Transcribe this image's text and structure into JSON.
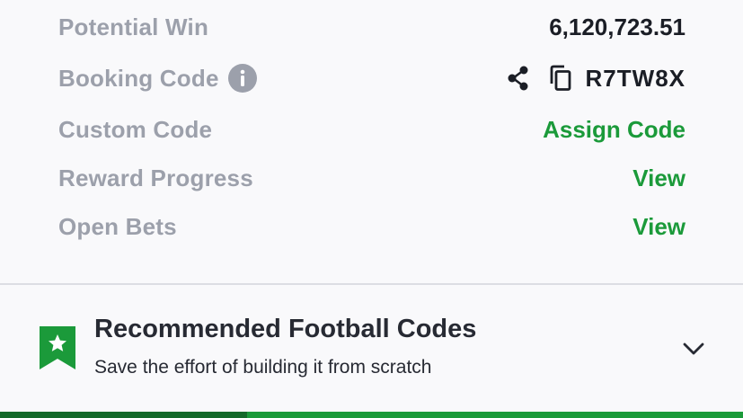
{
  "bet_details": {
    "potential_win": {
      "label": "Potential Win",
      "value": "6,120,723.51"
    },
    "booking_code": {
      "label": "Booking Code",
      "value": "R7TW8X",
      "info_icon": "info-icon",
      "share_icon": "share-icon",
      "copy_icon": "copy-icon"
    },
    "custom_code": {
      "label": "Custom Code",
      "action": "Assign Code"
    },
    "reward_progress": {
      "label": "Reward Progress",
      "action": "View"
    },
    "open_bets": {
      "label": "Open Bets",
      "action": "View"
    }
  },
  "recommended": {
    "title": "Recommended Football Codes",
    "subtitle": "Save the effort of building it from scratch",
    "icon": "bookmark-star-icon",
    "toggle_icon": "chevron-down-icon"
  },
  "progress": {
    "fraction": 0.333
  },
  "colors": {
    "accent_green": "#1b9a3a",
    "dark_green": "#146a2a",
    "label_gray": "#9ca0ab",
    "text_dark": "#1b1e26",
    "background": "#f9f9fb",
    "divider": "#dcdde3"
  }
}
